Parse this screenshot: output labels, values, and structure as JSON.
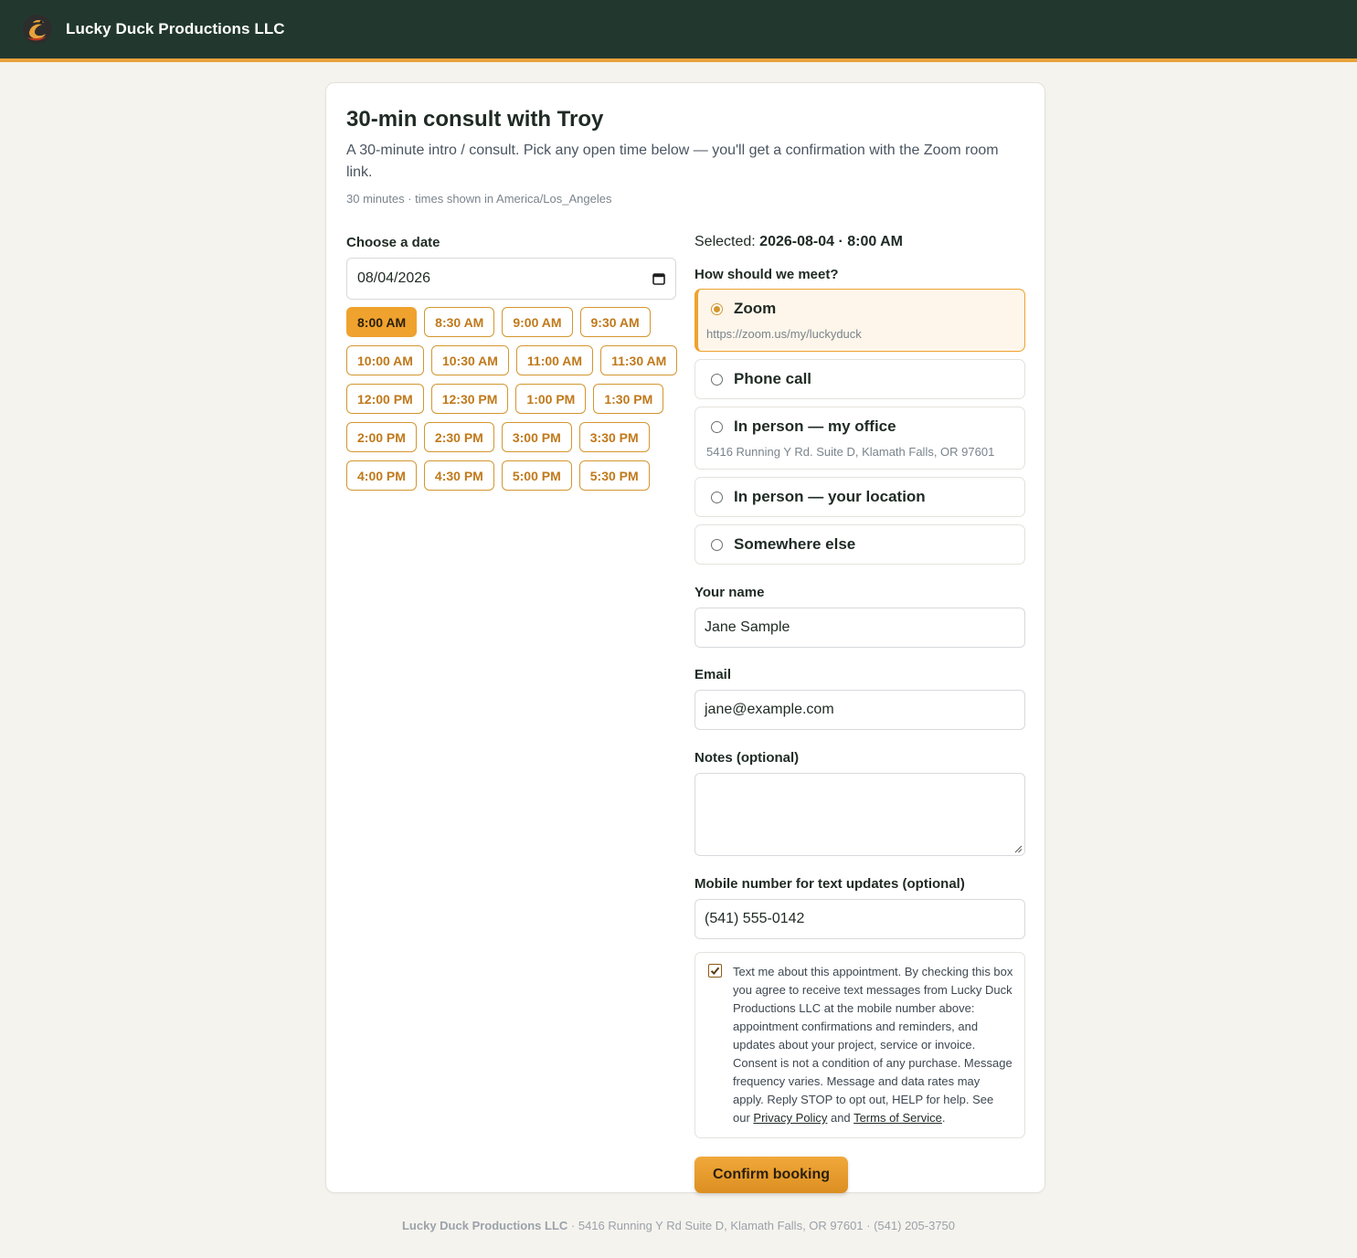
{
  "header": {
    "brand": "Lucky Duck Productions LLC"
  },
  "booking": {
    "title": "30-min consult with Troy",
    "description": "A 30-minute intro / consult. Pick any open time below — you'll get a confirmation with the Zoom room link.",
    "meta": "30 minutes · times shown in America/Los_Angeles"
  },
  "date_picker": {
    "label": "Choose a date",
    "value": "08/04/2026"
  },
  "slots": [
    {
      "label": "8:00 AM",
      "selected": true
    },
    {
      "label": "8:30 AM"
    },
    {
      "label": "9:00 AM"
    },
    {
      "label": "9:30 AM"
    },
    {
      "label": "10:00 AM"
    },
    {
      "label": "10:30 AM"
    },
    {
      "label": "11:00 AM"
    },
    {
      "label": "11:30 AM"
    },
    {
      "label": "12:00 PM"
    },
    {
      "label": "12:30 PM"
    },
    {
      "label": "1:00 PM"
    },
    {
      "label": "1:30 PM"
    },
    {
      "label": "2:00 PM"
    },
    {
      "label": "2:30 PM"
    },
    {
      "label": "3:00 PM"
    },
    {
      "label": "3:30 PM"
    },
    {
      "label": "4:00 PM"
    },
    {
      "label": "4:30 PM"
    },
    {
      "label": "5:00 PM"
    },
    {
      "label": "5:30 PM"
    }
  ],
  "selection": {
    "prefix": "Selected:",
    "value": "2026-08-04 · 8:00 AM"
  },
  "meeting": {
    "label": "How should we meet?",
    "options": [
      {
        "label": "Zoom",
        "sub": "https://zoom.us/my/luckyduck",
        "checked": true
      },
      {
        "label": "Phone call"
      },
      {
        "label": "In person — my office",
        "sub": "5416 Running Y Rd. Suite D, Klamath Falls, OR 97601"
      },
      {
        "label": "In person — your location"
      },
      {
        "label": "Somewhere else"
      }
    ]
  },
  "form": {
    "name_label": "Your name",
    "name_value": "Jane Sample",
    "email_label": "Email",
    "email_value": "jane@example.com",
    "notes_label": "Notes (optional)",
    "notes_value": "",
    "mobile_label": "Mobile number for text updates (optional)",
    "mobile_value": "(541) 555-0142"
  },
  "consent": {
    "checked": true,
    "text": "Text me about this appointment. By checking this box you agree to receive text messages from Lucky Duck Productions LLC at the mobile number above: appointment confirmations and reminders, and updates about your project, service or invoice. Consent is not a condition of any purchase. Message frequency varies. Message and data rates may apply. Reply STOP to opt out, HELP for help. See our",
    "privacy_link": "Privacy Policy",
    "and": "and",
    "terms_link": "Terms of Service",
    "end": "."
  },
  "confirm_label": "Confirm booking",
  "footer": {
    "company": "Lucky Duck Productions LLC",
    "details": " · 5416 Running Y Rd Suite D, Klamath Falls, OR 97601 · (541) 205-3750"
  },
  "colors": {
    "header_bg": "#22382f",
    "accent": "#efa22e",
    "slot_text": "#c0791a"
  },
  "icons": [
    "duck-logo-icon",
    "calendar-icon",
    "checkmark-icon",
    "resize-grip-icon"
  ]
}
